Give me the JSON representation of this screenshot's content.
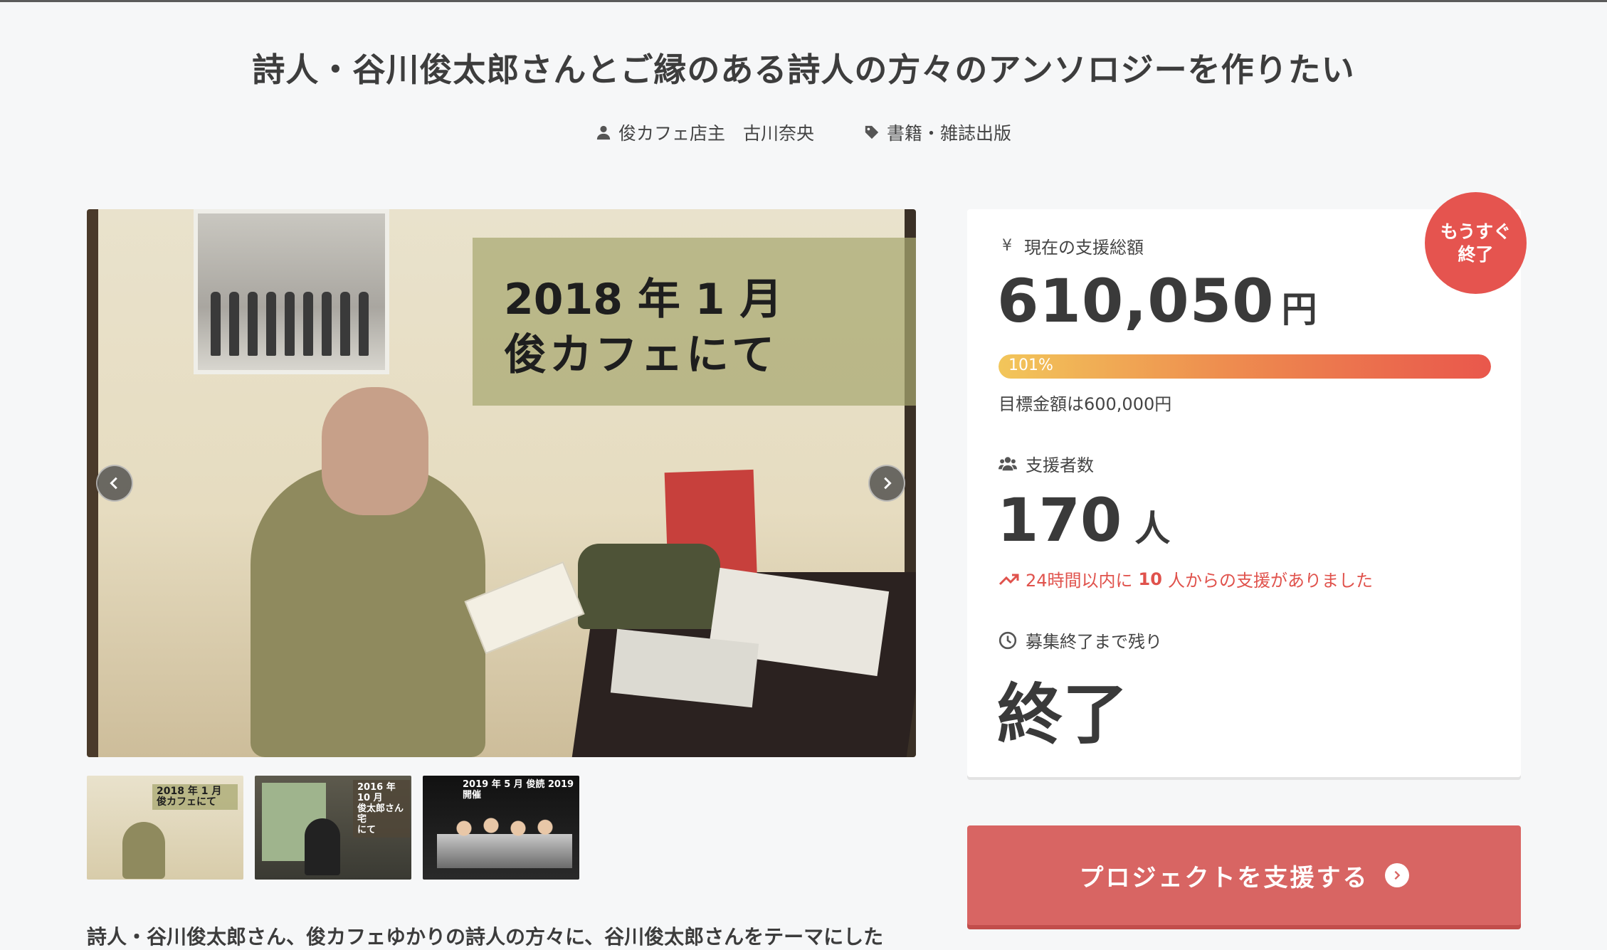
{
  "project": {
    "title": "詩人・谷川俊太郎さんとご縁のある詩人の方々のアンソロジーを作りたい",
    "owner": "俊カフェ店主　古川奈央",
    "category": "書籍・雑誌出版"
  },
  "gallery": {
    "main_caption_line1": "2018 年 1 月",
    "main_caption_line2": "俊カフェにて",
    "thumbnails": [
      {
        "caption": "2018 年 1 月\n俊カフェにて"
      },
      {
        "caption": "2016 年 10 月\n俊太郎さん宅\nにて"
      },
      {
        "caption": "2019 年 5 月 俊読 2019 開催"
      }
    ]
  },
  "description": "詩人・谷川俊太郎さん、俊カフェゆかりの詩人の方々に、谷川俊太郎さんをテーマにした",
  "status": {
    "badge": "もうすぐ\n終了",
    "amount_label": "現在の支援総額",
    "amount": "610,050",
    "amount_unit": "円",
    "progress_percent": 101,
    "progress_label": "101%",
    "goal": "目標金額は600,000円",
    "backers_label": "支援者数",
    "backers": "170",
    "backers_unit": "人",
    "trend_prefix": "24時間以内に",
    "trend_count": "10",
    "trend_suffix": "人からの支援がありました",
    "remaining_label": "募集終了まで残り",
    "remaining": "終了"
  },
  "cta": {
    "label": "プロジェクトを支援する"
  },
  "colors": {
    "accent": "#e5544f",
    "button": "#d86563",
    "text": "#3a3a3a"
  }
}
